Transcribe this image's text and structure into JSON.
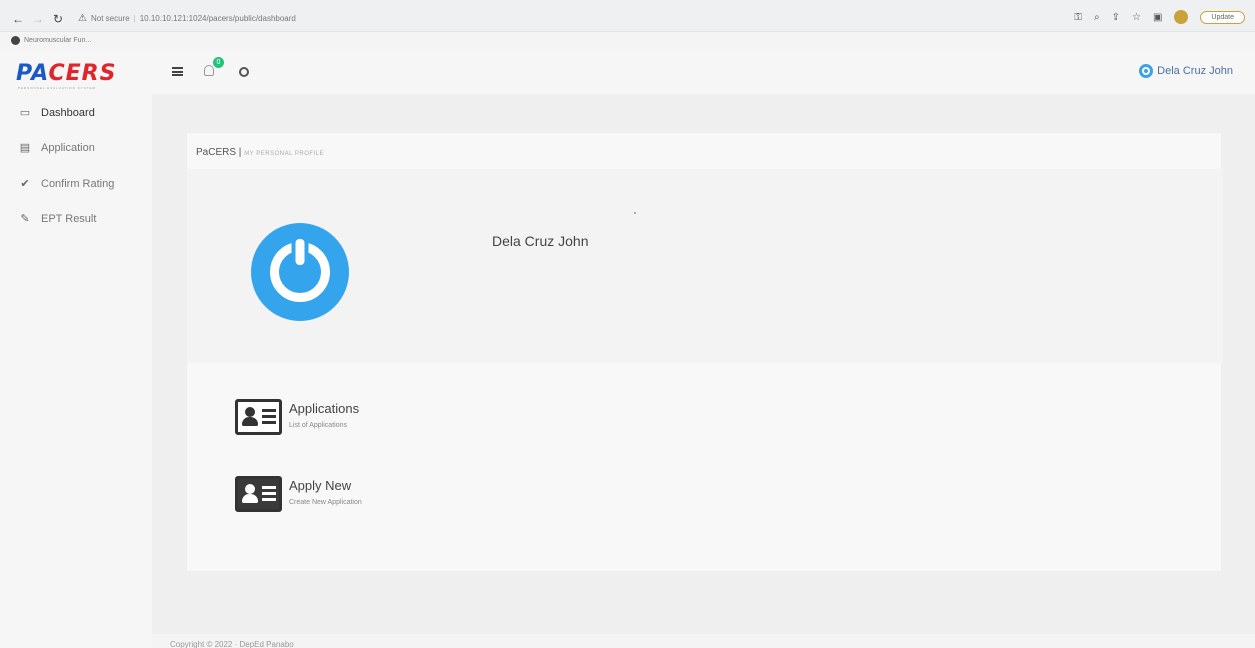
{
  "browser": {
    "address_warning": "Not secure",
    "url": "10.10.10.121:1024/pacers/public/dashboard",
    "update_label": "Update",
    "bookmark_label": "Neuromuscular Fun..."
  },
  "header": {
    "logo_part1": "PA",
    "logo_part2": "CERS",
    "logo_subtitle": "PERSONNEL EVALUATION SYSTEM",
    "notification_count": "0",
    "user_name": "Dela Cruz John"
  },
  "sidebar": {
    "items": [
      {
        "label": "Dashboard",
        "icon": "monitor-icon"
      },
      {
        "label": "Application",
        "icon": "id-card-icon"
      },
      {
        "label": "Confirm Rating",
        "icon": "check-icon"
      },
      {
        "label": "EPT Result",
        "icon": "edit-icon"
      }
    ]
  },
  "main": {
    "breadcrumb_app": "PaCERS",
    "breadcrumb_sep": "|",
    "breadcrumb_page": "MY PERSONAL PROFILE",
    "profile_name": "Dela Cruz John",
    "tiles": [
      {
        "title": "Applications",
        "subtitle": "List of Applications"
      },
      {
        "title": "Apply New",
        "subtitle": "Create New Application"
      }
    ]
  },
  "footer": {
    "copyright": "Copyright © 2022 · DepEd Panabo"
  },
  "colors": {
    "brand_blue": "#1a58c8",
    "brand_red": "#e0262a",
    "accent_power": "#34a5ec",
    "badge_green": "#22c47a"
  }
}
